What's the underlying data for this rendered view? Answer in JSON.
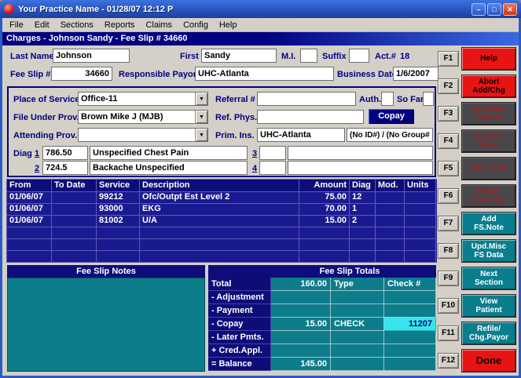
{
  "colors": {
    "navy": "#000080",
    "teal": "#0d7c8b",
    "red": "#e81414",
    "cyan": "#38e4ee",
    "window_gray": "#d4d0c8",
    "title_blue": "#2b5cc4"
  },
  "icons": {
    "dropdown_arrow": "▼"
  },
  "window": {
    "title": "Your Practice Name  -  01/28/07 12:12 P",
    "controls": {
      "minimize": "–",
      "maximize": "□",
      "close": "✕"
    }
  },
  "menu": {
    "items": [
      "File",
      "Edit",
      "Sections",
      "Reports",
      "Claims",
      "Config",
      "Help"
    ]
  },
  "subtitle": "Charges - Johnson Sandy - Fee Slip # 34660",
  "patient": {
    "last_name_label": "Last Name",
    "last_name": "Johnson",
    "first_label": "First",
    "first_name": "Sandy",
    "mi_label": "M.I.",
    "mi": "",
    "suffix_label": "Suffix",
    "suffix": "",
    "account_label": "Act.#",
    "account_number": "18",
    "fee_slip_label": "Fee Slip #",
    "fee_slip_number": "34660",
    "responsible_payor_label": "Responsible Payor",
    "responsible_payor": "UHC-Atlanta",
    "business_date_label": "Business Date",
    "business_date": "1/6/2007"
  },
  "encounter": {
    "place_of_service_label": "Place of Service",
    "place_of_service": "Office-11",
    "referral_label": "Referral #",
    "referral": "",
    "auth_label": "Auth.",
    "auth": "",
    "so_far_label": "So Far",
    "so_far": "",
    "file_under_prov_label": "File Under Prov.",
    "file_under_prov": "Brown Mike J (MJB)",
    "ref_phys_label": "Ref. Phys.",
    "ref_phys": "",
    "copay_button": "Copay",
    "attending_prov_label": "Attending Prov.",
    "attending_prov": "",
    "prim_ins_label": "Prim. Ins.",
    "prim_ins": "UHC-Atlanta",
    "prim_ins_ids": "(No ID#) / (No Group#)",
    "diag_label": "Diag",
    "diag": [
      {
        "num": "1",
        "code": "786.50",
        "desc": "Unspecified Chest Pain"
      },
      {
        "num": "2",
        "code": "724.5",
        "desc": "Backache Unspecified"
      },
      {
        "num": "3",
        "code": "",
        "desc": ""
      },
      {
        "num": "4",
        "code": "",
        "desc": ""
      }
    ]
  },
  "services": {
    "columns": [
      "From",
      "To Date",
      "Service",
      "Description",
      "Amount",
      "Diag",
      "Mod.",
      "Units"
    ],
    "rows": [
      {
        "from": "01/06/07",
        "to_date": "",
        "service": "99212",
        "description": "Ofc/Outpt Est Level 2",
        "amount": "75.00",
        "diag": "12",
        "mod": "",
        "units": ""
      },
      {
        "from": "01/06/07",
        "to_date": "",
        "service": "93000",
        "description": "EKG",
        "amount": "70.00",
        "diag": "1",
        "mod": "",
        "units": ""
      },
      {
        "from": "01/06/07",
        "to_date": "",
        "service": "81002",
        "description": "U/A",
        "amount": "15.00",
        "diag": "2",
        "mod": "",
        "units": ""
      }
    ]
  },
  "notes": {
    "title": "Fee Slip Notes",
    "text": ""
  },
  "totals": {
    "title": "Fee Slip Totals",
    "type_header": "Type",
    "check_header": "Check #",
    "rows": [
      {
        "label": "Total",
        "value": "160.00",
        "type": "",
        "check": ""
      },
      {
        "label": "- Adjustment",
        "value": "",
        "type": "",
        "check": ""
      },
      {
        "label": "- Payment",
        "value": "",
        "type": "",
        "check": ""
      },
      {
        "label": "- Copay",
        "value": "15.00",
        "type": "CHECK",
        "check": "11207"
      },
      {
        "label": "- Later Pmts.",
        "value": "",
        "type": "",
        "check": ""
      },
      {
        "label": "+ Cred.Appl.",
        "value": "",
        "type": "",
        "check": ""
      },
      {
        "label": "= Balance",
        "value": "145.00",
        "type": "",
        "check": ""
      }
    ]
  },
  "function_keys": [
    {
      "key": "F1",
      "label": "Help",
      "state": "enabled"
    },
    {
      "key": "F2",
      "label": "Abort\nAdd/Chg",
      "state": "enabled"
    },
    {
      "key": "F3",
      "label": "Add New\nPatient",
      "state": "disabled"
    },
    {
      "key": "F4",
      "label": "Service\nNote",
      "state": "disabled"
    },
    {
      "key": "F5",
      "label": "Not Used",
      "state": "disabled"
    },
    {
      "key": "F6",
      "label": "Recall\nFee Slip",
      "state": "disabled"
    },
    {
      "key": "F7",
      "label": "Add\nFS.Note",
      "state": "enabled"
    },
    {
      "key": "F8",
      "label": "Upd.Misc\nFS Data",
      "state": "enabled"
    },
    {
      "key": "F9",
      "label": "Next\nSection",
      "state": "enabled"
    },
    {
      "key": "F10",
      "label": "View\nPatient",
      "state": "enabled"
    },
    {
      "key": "F11",
      "label": "Refile/\nChg.Payor",
      "state": "enabled"
    },
    {
      "key": "F12",
      "label": "Done",
      "state": "enabled"
    }
  ]
}
